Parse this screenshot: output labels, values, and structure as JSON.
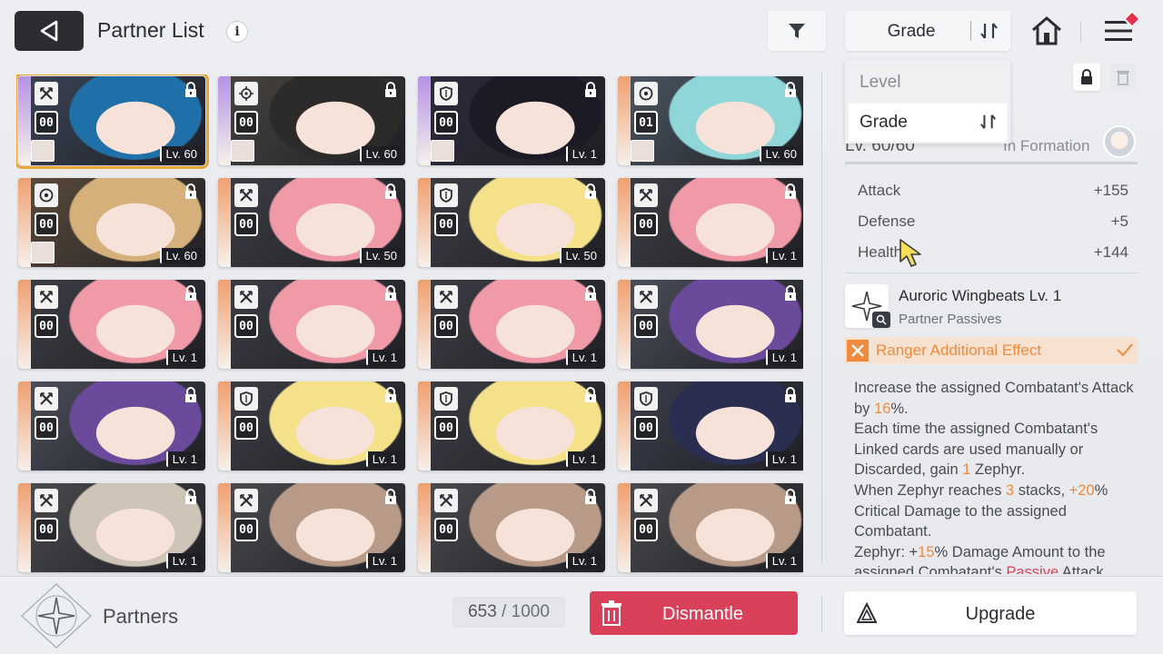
{
  "header": {
    "title": "Partner List",
    "info_symbol": "i",
    "sort_label": "Grade",
    "icons": {
      "back": "back-arrow-icon",
      "filter": "filter-icon",
      "sort": "sort-order-icon",
      "home": "home-icon",
      "menu": "menu-icon"
    }
  },
  "sort_dropdown": {
    "options": [
      "Level",
      "Grade"
    ],
    "selected": "Grade"
  },
  "cards": [
    {
      "level": "Lv. 60",
      "count": "00",
      "class": "ranger",
      "stripe": "#b592e6",
      "hair": "#1f6fa8",
      "bg": "#3a4255",
      "selected": true,
      "equip": true
    },
    {
      "level": "Lv. 60",
      "count": "00",
      "class": "target",
      "stripe": "#b592e6",
      "hair": "#2d2b2a",
      "bg": "#46433f",
      "equip": true
    },
    {
      "level": "Lv. 1",
      "count": "00",
      "class": "shield",
      "stripe": "#b592e6",
      "hair": "#1c1a25",
      "bg": "#2d2a3a",
      "equip": true
    },
    {
      "level": "Lv. 60",
      "count": "01",
      "class": "circle",
      "stripe": "#f0a070",
      "hair": "#8fd6d8",
      "bg": "#4b5560",
      "equip": true
    },
    {
      "level": "Lv. 60",
      "count": "00",
      "class": "circle",
      "stripe": "#f0a070",
      "hair": "#d6b07a",
      "bg": "#5a4a3a",
      "equip": true
    },
    {
      "level": "Lv. 50",
      "count": "00",
      "class": "ranger",
      "stripe": "#f0a070",
      "hair": "#f09aa8",
      "bg": "#3c3d44"
    },
    {
      "level": "Lv. 50",
      "count": "00",
      "class": "shield",
      "stripe": "#f0a070",
      "hair": "#f4e18a",
      "bg": "#3c3d44"
    },
    {
      "level": "Lv. 1",
      "count": "00",
      "class": "ranger",
      "stripe": "#f0a070",
      "hair": "#f09aa8",
      "bg": "#3c3d44"
    },
    {
      "level": "Lv. 1",
      "count": "00",
      "class": "ranger",
      "stripe": "#f0a070",
      "hair": "#f09aa8",
      "bg": "#3c3d44"
    },
    {
      "level": "Lv. 1",
      "count": "00",
      "class": "ranger",
      "stripe": "#f0a070",
      "hair": "#f09aa8",
      "bg": "#3c3d44"
    },
    {
      "level": "Lv. 1",
      "count": "00",
      "class": "ranger",
      "stripe": "#f0a070",
      "hair": "#f09aa8",
      "bg": "#3c3d44"
    },
    {
      "level": "Lv. 1",
      "count": "00",
      "class": "ranger",
      "stripe": "#f0a070",
      "hair": "#6a4a9a",
      "bg": "#4a4d58"
    },
    {
      "level": "Lv. 1",
      "count": "00",
      "class": "ranger",
      "stripe": "#f0a070",
      "hair": "#6a4a9a",
      "bg": "#4a4d58"
    },
    {
      "level": "Lv. 1",
      "count": "00",
      "class": "shield",
      "stripe": "#f0a070",
      "hair": "#f4e18a",
      "bg": "#3c3d44"
    },
    {
      "level": "Lv. 1",
      "count": "00",
      "class": "shield",
      "stripe": "#f0a070",
      "hair": "#f4e18a",
      "bg": "#3c3d44"
    },
    {
      "level": "Lv. 1",
      "count": "00",
      "class": "shield",
      "stripe": "#f0a070",
      "hair": "#2a2f52",
      "bg": "#3a3d4a"
    },
    {
      "level": "Lv. 1",
      "count": "00",
      "class": "ranger",
      "stripe": "#f0a070",
      "hair": "#cfc4b8",
      "bg": "#4a4a4e"
    },
    {
      "level": "Lv. 1",
      "count": "00",
      "class": "ranger",
      "stripe": "#f0a070",
      "hair": "#b89a88",
      "bg": "#4a4a4e"
    },
    {
      "level": "Lv. 1",
      "count": "00",
      "class": "ranger",
      "stripe": "#f0a070",
      "hair": "#b89a88",
      "bg": "#4a4a4e"
    },
    {
      "level": "Lv. 1",
      "count": "00",
      "class": "ranger",
      "stripe": "#f0a070",
      "hair": "#b89a88",
      "bg": "#4a4a4e"
    }
  ],
  "detail": {
    "level_text": "Lv. 60/60",
    "formation_text": "In Formation",
    "stats": [
      {
        "label": "Attack",
        "value": "+155"
      },
      {
        "label": "Defense",
        "value": "+5"
      },
      {
        "label": "Health",
        "value": "+144"
      }
    ],
    "passive_name": "Auroric Wingbeats Lv. 1",
    "passive_sub": "Partner Passives",
    "ranger_label": "Ranger Additional Effect",
    "description": {
      "p1a": "Increase the assigned Combatant's Attack by ",
      "p1b": "16",
      "p1c": "%.",
      "p2a": "Each time the assigned Combatant's Linked cards are used manually or Discarded, gain ",
      "p2b": "1",
      "p2c": " Zephyr.",
      "p3a": "When Zephyr reaches ",
      "p3b": "3",
      "p3c": " stacks, ",
      "p3d": "+20",
      "p3e": "% Critical Damage to the assigned Combatant.",
      "p4a": "Zephyr: +",
      "p4b": "15",
      "p4c": "% Damage Amount to the assigned Combatant's ",
      "p4d": "Passive",
      "p4e": " Attack"
    }
  },
  "footer": {
    "partners_label": "Partners",
    "capacity_current": "653",
    "capacity_sep": " / ",
    "capacity_max": "1000",
    "dismantle_label": "Dismantle",
    "upgrade_label": "Upgrade"
  },
  "colors": {
    "accent_orange": "#f08a3c",
    "dismantle_red": "#d9415a",
    "selected_outline": "#e9a53a"
  }
}
